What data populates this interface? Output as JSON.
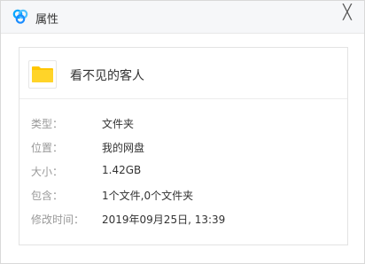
{
  "window": {
    "title": "属性",
    "close_glyph": "╳"
  },
  "file": {
    "name": "看不见的客人",
    "icon": "folder-icon"
  },
  "properties": [
    {
      "label": "类型：",
      "value": "文件夹"
    },
    {
      "label": "位置：",
      "value": "我的网盘"
    },
    {
      "label": "大小：",
      "value": "1.42GB"
    },
    {
      "label": "包含：",
      "value": "1个文件,0个文件夹"
    },
    {
      "label": "修改时间：",
      "value": "2019年09月25日, 13:39"
    }
  ],
  "colors": {
    "accent": "#06a7ff",
    "folder": "#ffc600"
  }
}
